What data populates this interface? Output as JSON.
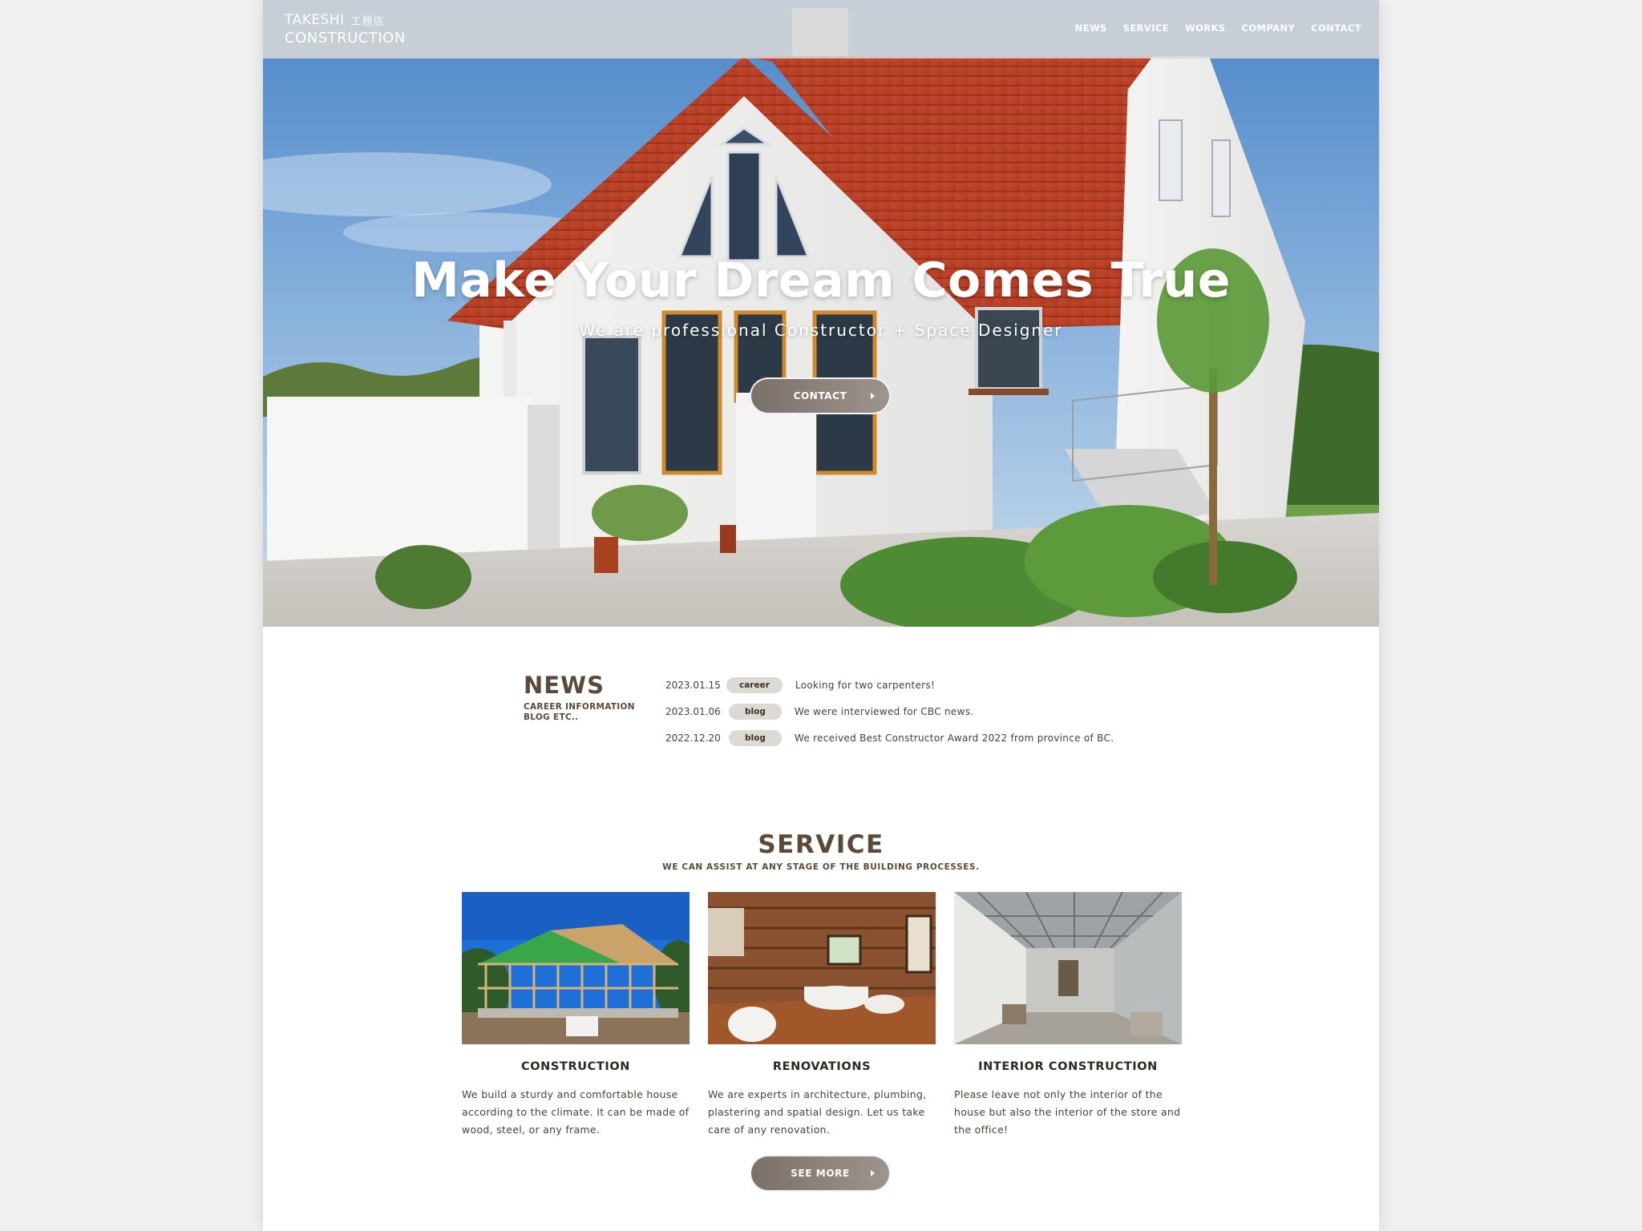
{
  "header": {
    "logo_line1": "TAKESHI",
    "logo_kanji": "工務店",
    "logo_line2": "CONSTRUCTION",
    "nav": [
      "NEWS",
      "SERVICE",
      "WORKS",
      "COMPANY",
      "CONTACT"
    ]
  },
  "hero": {
    "title": "Make Your Dream Comes True",
    "subtitle": "We are professional Constructor + Space Designer",
    "cta_label": "CONTACT"
  },
  "news": {
    "title": "NEWS",
    "subtitle_line1": "CAREER INFORMATION",
    "subtitle_line2": "BLOG ETC..",
    "items": [
      {
        "date": "2023.01.15",
        "tag": "career",
        "text": "Looking for two carpenters!"
      },
      {
        "date": "2023.01.06",
        "tag": "blog",
        "text": "We were interviewed for CBC news."
      },
      {
        "date": "2022.12.20",
        "tag": "blog",
        "text": "We received Best Constructor Award 2022 from province of BC."
      }
    ]
  },
  "service": {
    "title": "SERVICE",
    "subtitle": "WE CAN ASSIST AT ANY STAGE OF THE BUILDING PROCESSES.",
    "cards": [
      {
        "title": "CONSTRUCTION",
        "desc": "We build a sturdy and comfortable house according to the climate. It can be made of wood, steel, or any frame."
      },
      {
        "title": "RENOVATIONS",
        "desc": "We are experts in architecture, plumbing, plastering and spatial design. Let us take care of any renovation."
      },
      {
        "title": "INTERIOR CONSTRUCTION",
        "desc": "Please leave not only the interior of the house but also the interior of the store and the office!"
      }
    ],
    "see_more_label": "SEE MORE"
  },
  "colors": {
    "accent_brown": "#5a4a3a",
    "button_gradient_start": "#7a7069",
    "tag_bg": "#ddd9d5"
  }
}
